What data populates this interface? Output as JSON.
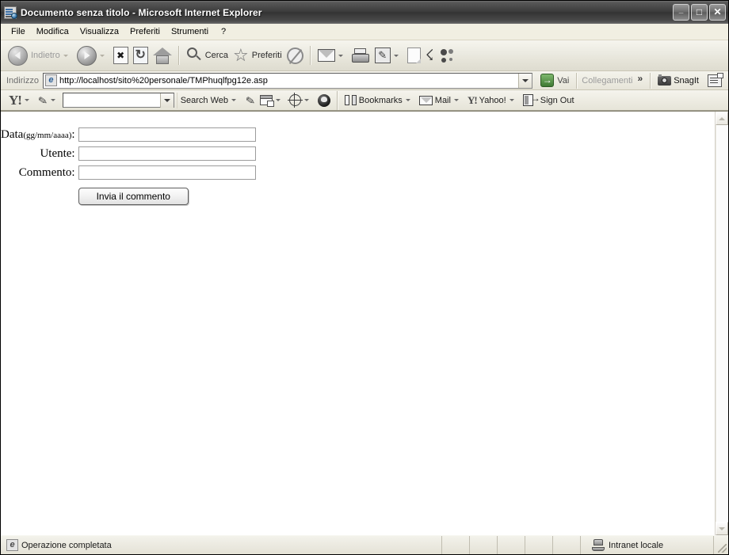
{
  "window": {
    "title": "Documento senza titolo - Microsoft Internet Explorer",
    "app_icon": "ie-document-icon",
    "caption": {
      "minimize": "_",
      "maximize": "□",
      "close": "✕"
    }
  },
  "menubar": {
    "items": [
      {
        "label": "File"
      },
      {
        "label": "Modifica"
      },
      {
        "label": "Visualizza"
      },
      {
        "label": "Preferiti"
      },
      {
        "label": "Strumenti"
      },
      {
        "label": "?"
      }
    ]
  },
  "toolbar": {
    "back_label": "Indietro",
    "search_label": "Cerca",
    "favorites_label": "Preferiti",
    "icons": {
      "back": "back-arrow-icon",
      "forward": "forward-arrow-icon",
      "stop": "stop-icon",
      "refresh": "refresh-icon",
      "home": "home-icon",
      "search": "search-magnifier-icon",
      "favorites": "favorites-star-icon",
      "media": "media-icon",
      "mail": "mail-icon",
      "print": "print-icon",
      "edit": "edit-page-icon",
      "blank": "blank-page-icon",
      "discuss": "discuss-icon",
      "messenger": "messenger-people-icon"
    }
  },
  "addressbar": {
    "label": "Indirizzo",
    "url": "http://localhost/sito%20personale/TMPhuqlfpg12e.asp",
    "placeholder": "",
    "go_label": "Vai",
    "links_label": "Collegamenti",
    "chevrons": "»",
    "snagit_label": "SnagIt"
  },
  "yahoo_toolbar": {
    "logo": "Y!",
    "search_value": "",
    "search_placeholder": "",
    "search_web_label": "Search Web",
    "bookmarks_label": "Bookmarks",
    "mail_label": "Mail",
    "yahoo_label": "Yahoo!",
    "signout_label": "Sign Out"
  },
  "page": {
    "form": {
      "rows": [
        {
          "label": "Data",
          "label_small": "(gg/mm/aaaa)",
          "suffix": ":",
          "value": "",
          "placeholder": ""
        },
        {
          "label": "Utente",
          "label_small": "",
          "suffix": ":",
          "value": "",
          "placeholder": ""
        },
        {
          "label": "Commento",
          "label_small": "",
          "suffix": ":",
          "value": "",
          "placeholder": ""
        }
      ],
      "submit_label": "Invia il commento"
    }
  },
  "statusbar": {
    "text": "Operazione completata",
    "zone": "Intranet locale",
    "zone_icon": "local-intranet-icon"
  },
  "colors": {
    "titlebar_dark": "#3d3d3d",
    "chrome": "#ece9d8",
    "page_background": "#ffffff",
    "go_button_green": "#3f7a33"
  }
}
